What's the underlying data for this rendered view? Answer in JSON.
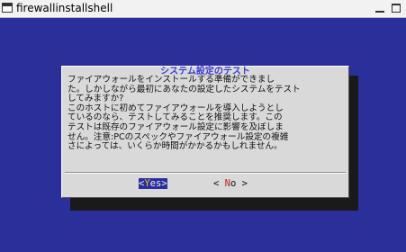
{
  "window": {
    "title": "firewallinstallshell"
  },
  "dialog": {
    "title": "システム設定のテスト",
    "body": "ファイアウォールをインストールする準備ができまし\nた。しかしながら最初にあなたの設定したシステムをテスト\nしてみますか?\nこのホストに初めてファイアウォールを導入しようとし\nているのなら、テストしてみることを推奨します。この\nテストは既存のファイアウォール設定に影響を及ぼしま\nせん。注意:PCのスペックやファイアウォール設定の複雑\nさによっては、いくらか時間がかかるかもしれません。"
  },
  "buttons": {
    "yes": {
      "open": "<",
      "hot": "Y",
      "rest": "es",
      "close": ">"
    },
    "no": {
      "open": "<",
      "hot": "N",
      "rest": "o",
      "close": ">"
    }
  },
  "colors": {
    "background": "#2b2f9a",
    "dialog": "#d9d9d9",
    "title": "#3b3bd6"
  }
}
